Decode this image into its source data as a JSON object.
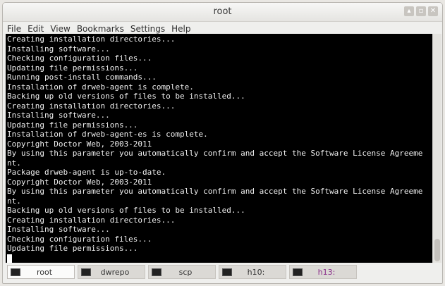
{
  "window": {
    "title": "root",
    "controls": {
      "minimize": "▴",
      "maximize": "▫",
      "close": "✕"
    }
  },
  "menu": [
    "File",
    "Edit",
    "View",
    "Bookmarks",
    "Settings",
    "Help"
  ],
  "terminal": {
    "lines": [
      "Creating installation directories...",
      "Installing software...",
      "Checking configuration files...",
      "Updating file permissions...",
      "Running post-install commands...",
      "Installation of drweb-agent is complete.",
      "Backing up old versions of files to be installed...",
      "Creating installation directories...",
      "Installing software...",
      "Updating file permissions...",
      "Installation of drweb-agent-es is complete.",
      "Copyright Doctor Web, 2003-2011",
      "By using this parameter you automatically confirm and accept the Software License Agreeme",
      "nt.",
      "Package drweb-agent is up-to-date.",
      "Copyright Doctor Web, 2003-2011",
      "By using this parameter you automatically confirm and accept the Software License Agreeme",
      "nt.",
      "Backing up old versions of files to be installed...",
      "Creating installation directories...",
      "Installing software...",
      "Checking configuration files...",
      "Updating file permissions..."
    ]
  },
  "tabs": [
    {
      "label": "root",
      "active": true,
      "icon": "terminal-icon"
    },
    {
      "label": "dwrepo",
      "active": false,
      "icon": "terminal-icon"
    },
    {
      "label": "scp",
      "active": false,
      "icon": "terminal-icon"
    },
    {
      "label": "h10:",
      "active": false,
      "icon": "terminal-icon"
    },
    {
      "label": "h13:",
      "active": false,
      "icon": "terminal-icon",
      "color": "#8b2f8b"
    }
  ]
}
